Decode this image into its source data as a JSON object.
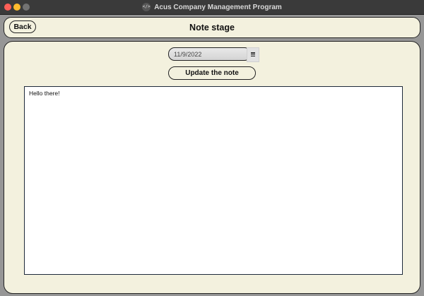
{
  "window": {
    "title": "Acus Company Management Program",
    "app_icon": "code-brackets-icon",
    "controls": {
      "close_color": "#ff5f57",
      "minimize_color": "#febc2e",
      "maximize_color": "#737373"
    }
  },
  "header": {
    "back_label": "Back",
    "title": "Note stage"
  },
  "main": {
    "date_value": "11/9/2022",
    "calendar_icon": "calendar-icon",
    "update_label": "Update the note",
    "note_text": "Hello there!"
  },
  "colors": {
    "panel_background": "#f3f1de",
    "window_background": "#969696",
    "border": "#222222"
  }
}
